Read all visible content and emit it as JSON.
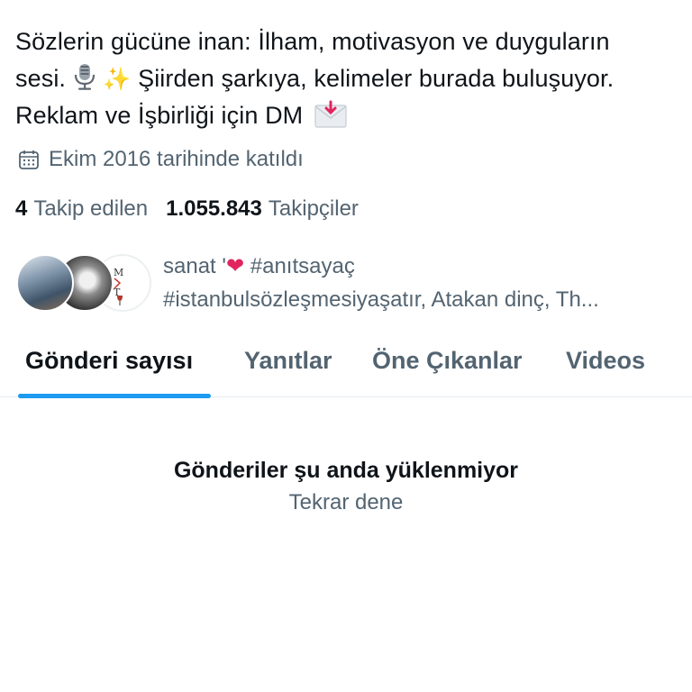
{
  "profile": {
    "bio_line1": "Sözlerin gücüne inan: İlham, motivasyon ve duyguların",
    "bio_line2_a": "sesi.",
    "bio_line2_b": "Şiirden şarkıya, kelimeler burada buluşuyor.",
    "bio_line3": "Reklam ve İşbirliği için DM",
    "bio_emojis": [
      "microphone-icon",
      "sparkles-icon",
      "envelope-icon"
    ],
    "joined": "Ekim 2016 tarihinde katıldı",
    "following_count": "4",
    "following_label": "Takip edilen",
    "followers_count": "1.055.843",
    "followers_label": "Takipçiler"
  },
  "followed_by": {
    "line1_a": "sanat '",
    "line1_b": "#anıtsayaç",
    "line2": "#istanbulsözleşmesiyaşatır, Atakan dinç, Th...",
    "avatar3_text": "MT"
  },
  "tabs": [
    {
      "label": "Gönderi sayısı",
      "active": true
    },
    {
      "label": "Yanıtlar",
      "active": false
    },
    {
      "label": "Öne Çıkanlar",
      "active": false
    },
    {
      "label": "Videos",
      "active": false
    }
  ],
  "feed_error": {
    "title": "Gönderiler şu anda yüklenmiyor",
    "retry": "Tekrar dene"
  },
  "colors": {
    "text_primary": "#0f1419",
    "text_secondary": "#536471",
    "accent": "#1d9bf0",
    "heart": "#e0245e"
  }
}
